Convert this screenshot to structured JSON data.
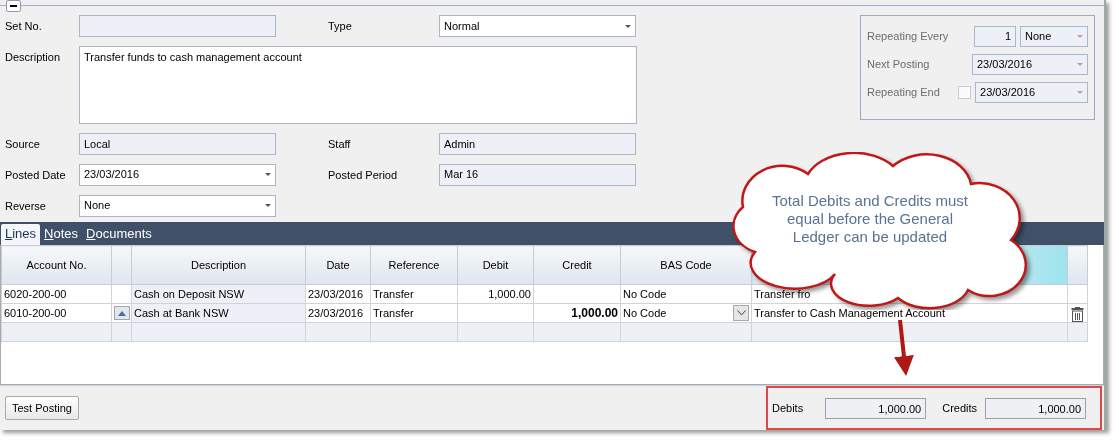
{
  "fields": [
    {
      "label": "Set No.",
      "kind": "text",
      "readonly": true
    },
    {
      "label": "Type",
      "kind": "combo",
      "value": "Normal",
      "readonly": false
    },
    {
      "label": "Description",
      "kind": "textarea",
      "value": "Transfer funds to cash management account",
      "readonly": false
    },
    {
      "label": "Source",
      "kind": "text",
      "value": "Local",
      "readonly": true
    },
    {
      "label": "Staff",
      "kind": "text",
      "value": "Admin",
      "readonly": true
    },
    {
      "label": "Posted Date",
      "kind": "combo",
      "value": "23/03/2016",
      "readonly": false
    },
    {
      "label": "Posted Period",
      "kind": "text",
      "value": "Mar 16",
      "readonly": true
    },
    {
      "label": "Reverse",
      "kind": "combo",
      "value": "None",
      "readonly": false
    }
  ],
  "repeat": {
    "disabled": true,
    "every_label": "Repeating Every",
    "count": "1",
    "unit": "None",
    "next_label": "Next Posting",
    "next": "23/03/2016",
    "end_label": "Repeating End",
    "end_checked": false,
    "end": "23/03/2016"
  },
  "tabs": [
    {
      "label": "Lines",
      "selected": true
    },
    {
      "label": "Notes",
      "selected": false
    },
    {
      "label": "Documents",
      "selected": false
    }
  ],
  "table": {
    "columns": [
      {
        "label": "Account No.",
        "kind": "text"
      },
      {
        "kind": "spin"
      },
      {
        "label": "Description",
        "kind": "text",
        "readonly": true
      },
      {
        "label": "Date",
        "kind": "text"
      },
      {
        "label": "Reference",
        "kind": "text"
      },
      {
        "label": "Debit",
        "kind": "amount"
      },
      {
        "label": "Credit",
        "kind": "amount"
      },
      {
        "label": "BAS Code",
        "kind": "combo"
      },
      {
        "kind": "memo"
      },
      {
        "kind": "delete"
      }
    ],
    "rows": [
      {
        "selected": false,
        "cells": [
          "6020-200-00",
          null,
          "Cash on Deposit NSW",
          "23/03/2016",
          "Transfer",
          "1,000.00",
          null,
          "No Code",
          "Transfer fro",
          null
        ]
      },
      {
        "selected": true,
        "cells": [
          "6010-200-00",
          null,
          "Cash at Bank NSW",
          "23/03/2016",
          "Transfer",
          null,
          "1,000.00",
          "No Code",
          "Transfer to Cash Management Account",
          null
        ]
      },
      {
        "selected": false,
        "kind": "new",
        "cells": [
          null,
          null,
          null,
          null,
          null,
          null,
          null,
          null,
          null,
          null
        ]
      }
    ]
  },
  "footer": {
    "button": "Test Posting",
    "debits_label": "Debits",
    "debits": "1,000.00",
    "credits_label": "Credits",
    "credits": "1,000.00"
  },
  "callout": {
    "text": "Total Debits and Credits must equal before the General Ledger can be updated"
  }
}
